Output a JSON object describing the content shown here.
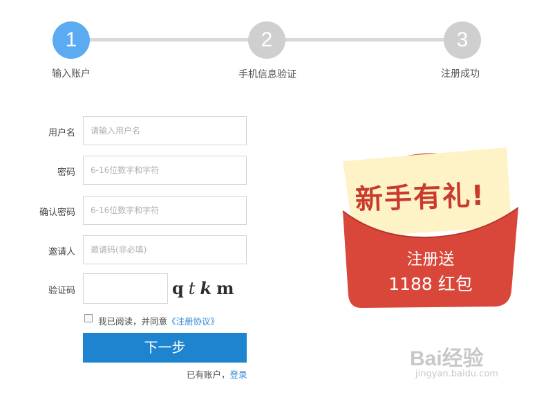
{
  "steps": [
    {
      "number": "1",
      "label": "输入账户",
      "active": true
    },
    {
      "number": "2",
      "label": "手机信息验证",
      "active": false
    },
    {
      "number": "3",
      "label": "注册成功",
      "active": false
    }
  ],
  "form": {
    "username": {
      "label": "用户名",
      "placeholder": "请输入用户名",
      "value": ""
    },
    "password": {
      "label": "密码",
      "placeholder": "6-16位数字和字符",
      "value": ""
    },
    "confirm_password": {
      "label": "确认密码",
      "placeholder": "6-16位数字和字符",
      "value": ""
    },
    "inviter": {
      "label": "邀请人",
      "placeholder": "邀请码(非必填)",
      "value": ""
    },
    "captcha": {
      "label": "验证码",
      "value": "",
      "image_text": [
        "q",
        "t",
        "k",
        "m"
      ]
    },
    "agreement": {
      "text": "我已阅读，并同意",
      "link": "《注册协议》",
      "checked": false
    },
    "next_button": "下一步",
    "login_prompt": "已有账户，",
    "login_link": "登录"
  },
  "promo": {
    "headline": "新手有礼!",
    "line1": "注册送",
    "line2": "1188 红包",
    "colors": {
      "envelope": "#d9473a",
      "paper": "#fdf3c6",
      "text": "#c93a2e"
    }
  },
  "watermark": {
    "main": "Bai经验",
    "sub": "jingyan.baidu.com"
  },
  "colors": {
    "active_step": "#5aabf1",
    "inactive_step": "#cfcfcf",
    "primary_button": "#1e84cf",
    "link": "#2f86d6"
  }
}
